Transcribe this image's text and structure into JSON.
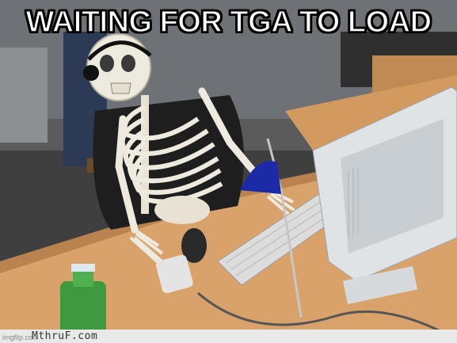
{
  "meme": {
    "caption": "WAITING FOR TGA TO LOAD",
    "watermark_site": "MthruF.com",
    "imgflip_tag": "imgflip.com"
  },
  "scene": {
    "subject": "skeleton-at-computer-desk",
    "colors": {
      "desk": "#d9a26b",
      "bone": "#efeadf",
      "monitor": "#dfe3e6",
      "lamp_shade": "#1d2aa8",
      "bottle": "#3f9a3f",
      "floor": "#4a4a4a"
    }
  }
}
